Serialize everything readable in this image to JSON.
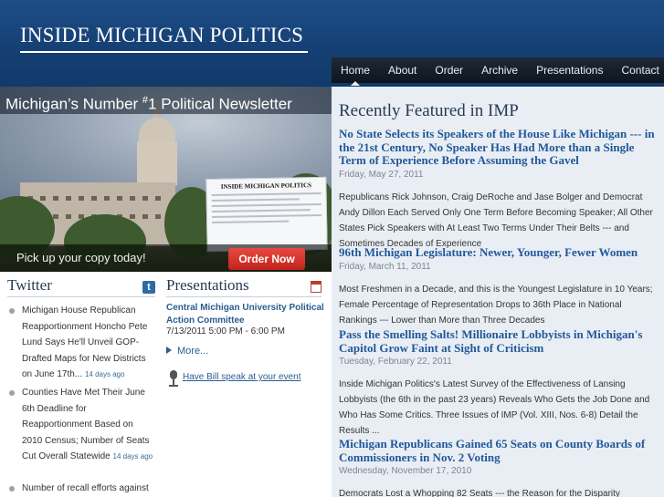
{
  "header": {
    "site_title": "INSIDE MICHIGAN POLITICS",
    "nav": [
      "Home",
      "About",
      "Order",
      "Archive",
      "Presentations",
      "Contact"
    ]
  },
  "hero": {
    "banner_text": "Michigan’s Number ",
    "banner_sup": "#",
    "banner_rest": "1 Political Newsletter",
    "newsletter_masthead": "INSIDE MICHIGAN POLITICS",
    "cta_text": "Pick up your copy today!",
    "order_button": "Order Now"
  },
  "twitter": {
    "title": "Twitter",
    "icon": "twitter-icon",
    "tweets": [
      {
        "text": "Michigan House Republican Reapportionment Honcho Pete Lund Says He'll Unveil GOP-Drafted Maps for New Districts on June 17th...",
        "ago": "14 days ago"
      },
      {
        "text": "Counties Have Met Their June 6th Deadline for Reapportionment Based on 2010 Census; Number of Seats Cut Overall Statewide",
        "ago": "14 days ago"
      },
      {
        "text": "Number of recall efforts against",
        "ago": ""
      }
    ]
  },
  "presentations": {
    "title": "Presentations",
    "icon": "calendar-icon",
    "event_title": "Central Michigan University Political Action Committee",
    "event_time": "7/13/2011 5:00 PM - 6:00 PM",
    "more_label": "More...",
    "speak_label": "Have Bill speak at your event"
  },
  "featured": {
    "heading": "Recently Featured in IMP",
    "articles": [
      {
        "title": "No State Selects its Speakers of the House Like Michigan --- in the 21st Century, No Speaker Has Had More than a Single Term of Experience Before Assuming the Gavel",
        "date": "Friday, May 27, 2011",
        "summary": "Republicans Rick Johnson, Craig DeRoche and Jase Bolger and Democrat Andy Dillon Each Served Only One Term Before Becoming Speaker; All Other States Pick Speakers with At Least Two Terms Under Their Belts --- and Sometimes Decades of Experience"
      },
      {
        "title": "96th Michigan Legislature: Newer, Younger, Fewer Women",
        "date": "Friday, March 11, 2011",
        "summary": "Most Freshmen in a Decade, and this is the Youngest Legislature in 10 Years; Female Percentage of Representation Drops to 36th Place  in National Rankings --- Lower than More than Three Decades"
      },
      {
        "title": "Pass the Smelling Salts! Millionaire Lobbyists in Michigan's Capitol Grow Faint at Sight of Criticism",
        "date": "Tuesday, February 22, 2011",
        "summary": "Inside Michigan Politics's Latest Survey of the Effectiveness of Lansing Lobbyists (the 6th in the past 23 years) Reveals Who Gets the Job Done and Who Has Some Critics. Three Issues of IMP (Vol. XIII, Nos. 6-8) Detail the Results ..."
      },
      {
        "title": "Michigan Republicans Gained 65 Seats on County Boards of Commissioners in Nov. 2 Voting",
        "date": "Wednesday, November 17, 2010",
        "summary": "Democrats Lost a Whopping 82 Seats --- the Reason for the Disparity"
      }
    ]
  }
}
